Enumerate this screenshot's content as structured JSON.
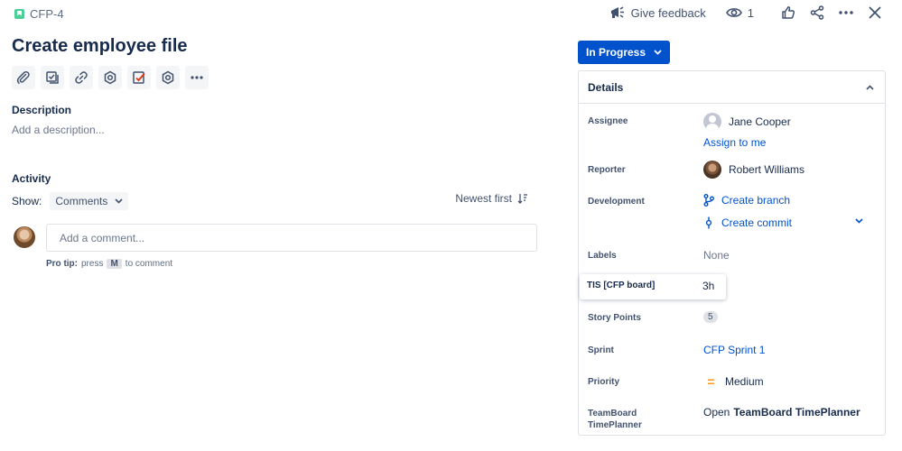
{
  "issue": {
    "key": "CFP-4",
    "title": "Create employee file"
  },
  "top_actions": {
    "feedback_label": "Give feedback",
    "watchers_count": "1"
  },
  "description": {
    "heading": "Description",
    "placeholder": "Add a description..."
  },
  "activity": {
    "heading": "Activity",
    "show_label": "Show:",
    "show_value": "Comments",
    "sort_label": "Newest first",
    "comment_placeholder": "Add a comment...",
    "protip_prefix": "Pro tip:",
    "protip_press": "press",
    "protip_key": "M",
    "protip_suffix": "to comment"
  },
  "status": {
    "label": "In Progress"
  },
  "details": {
    "heading": "Details",
    "assignee": {
      "label": "Assignee",
      "name": "Jane Cooper",
      "assign_to_me": "Assign to me"
    },
    "reporter": {
      "label": "Reporter",
      "name": "Robert Williams"
    },
    "development": {
      "label": "Development",
      "create_branch": "Create branch",
      "create_commit": "Create commit"
    },
    "labels": {
      "label": "Labels",
      "value": "None"
    },
    "tis": {
      "label": "TIS [CFP board]",
      "value": "3h"
    },
    "story_points": {
      "label": "Story Points",
      "value": "5"
    },
    "sprint": {
      "label": "Sprint",
      "value": "CFP Sprint 1"
    },
    "priority": {
      "label": "Priority",
      "value": "Medium",
      "color": "#ff991f"
    },
    "teamboard": {
      "label_line1": "TeamBoard",
      "label_line2": "TimePlanner",
      "open_prefix": "Open",
      "open_name": "TeamBoard TimePlanner"
    }
  },
  "colors": {
    "primary": "#0052cc",
    "text": "#172b4d",
    "subtle": "#6b778c",
    "key_icon": "#4bce97"
  }
}
